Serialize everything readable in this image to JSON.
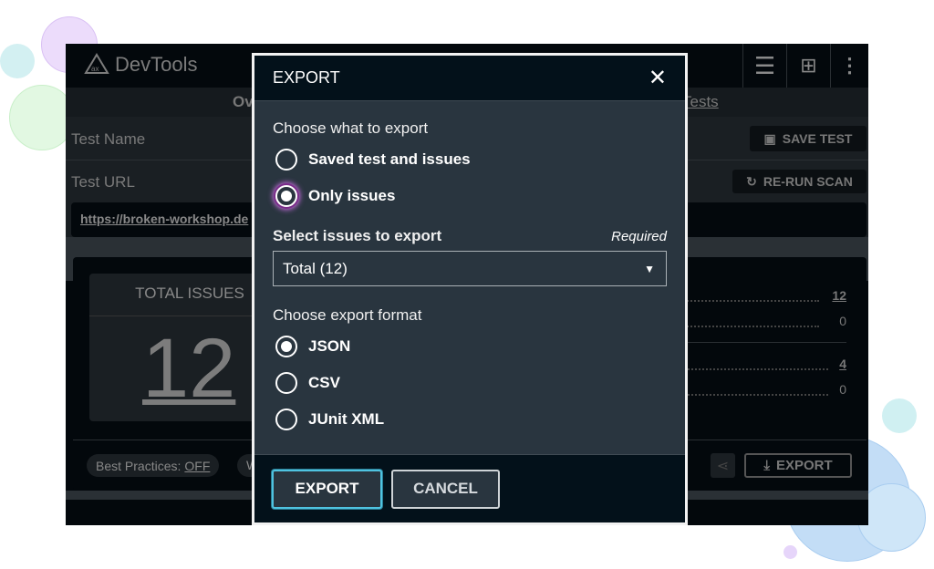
{
  "app": {
    "title": "DevTools",
    "logo_text": "ax"
  },
  "header_icons": [
    "list-icon",
    "add-copy-icon",
    "more-vertical-icon"
  ],
  "nav": {
    "left_tab": "Ov",
    "right_tab": "Tests"
  },
  "test_name": {
    "label": "Test Name",
    "save_button": "SAVE TEST"
  },
  "test_url": {
    "label": "Test URL",
    "rerun_button": "RE-RUN SCAN",
    "url": "https://broken-workshop.de"
  },
  "summary": {
    "total_label": "TOTAL ISSUES",
    "total_value": "12",
    "list_values": [
      "12",
      "0",
      "4",
      "0"
    ]
  },
  "footer": {
    "best_practices_label": "Best Practices:",
    "best_practices_value": "OFF",
    "second_pill": "W",
    "export_button": "EXPORT"
  },
  "modal": {
    "title": "EXPORT",
    "what_label": "Choose what to export",
    "what_options": [
      {
        "label": "Saved test and issues",
        "selected": false
      },
      {
        "label": "Only issues",
        "selected": true
      }
    ],
    "select_label": "Select issues to export",
    "required": "Required",
    "select_value": "Total (12)",
    "format_label": "Choose export format",
    "format_options": [
      {
        "label": "JSON",
        "selected": true
      },
      {
        "label": "CSV",
        "selected": false
      },
      {
        "label": "JUnit XML",
        "selected": false
      }
    ],
    "export_button": "EXPORT",
    "cancel_button": "CANCEL"
  },
  "colors": {
    "focus_ring": "#c86ee0",
    "primary_border": "#4fc3e0",
    "modal_bg": "#29353f"
  }
}
